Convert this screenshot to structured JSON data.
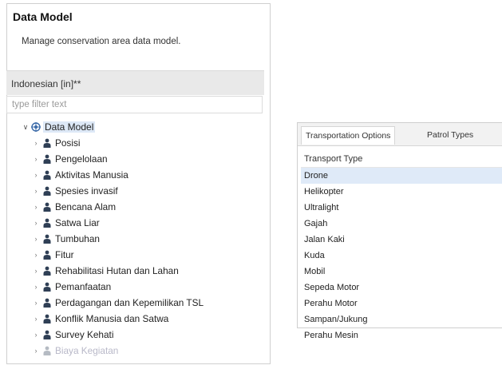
{
  "data_model_panel": {
    "title": "Data Model",
    "description": "Manage conservation area data model.",
    "language": "Indonesian [in]**",
    "filter_placeholder": "type filter text",
    "tree": {
      "root": "Data Model",
      "items": [
        {
          "label": "Posisi",
          "faded": false
        },
        {
          "label": "Pengelolaan",
          "faded": false
        },
        {
          "label": "Aktivitas Manusia",
          "faded": false
        },
        {
          "label": "Spesies invasif",
          "faded": false
        },
        {
          "label": "Bencana Alam",
          "faded": false
        },
        {
          "label": "Satwa Liar",
          "faded": false
        },
        {
          "label": "Tumbuhan",
          "faded": false
        },
        {
          "label": "Fitur",
          "faded": false
        },
        {
          "label": "Rehabilitasi Hutan dan Lahan",
          "faded": false
        },
        {
          "label": "Pemanfaatan",
          "faded": false
        },
        {
          "label": "Perdagangan dan Kepemilikan TSL",
          "faded": false
        },
        {
          "label": "Konflik Manusia dan Satwa",
          "faded": false
        },
        {
          "label": "Survey Kehati",
          "faded": false
        },
        {
          "label": "Biaya Kegiatan",
          "faded": true
        }
      ]
    },
    "icons": {
      "expand": "chevron-right-icon",
      "collapse": "chevron-down-icon",
      "category": "person-icon",
      "root": "data-model-icon"
    }
  },
  "transport_panel": {
    "tabs": [
      {
        "label": "Transportation Options",
        "active": true
      },
      {
        "label": "Patrol Types",
        "active": false
      }
    ],
    "column_header": "Transport Type",
    "rows": [
      {
        "label": "Drone",
        "selected": true
      },
      {
        "label": "Helikopter",
        "selected": false
      },
      {
        "label": "Ultralight",
        "selected": false
      },
      {
        "label": "Gajah",
        "selected": false
      },
      {
        "label": "Jalan Kaki",
        "selected": false
      },
      {
        "label": "Kuda",
        "selected": false
      },
      {
        "label": "Mobil",
        "selected": false
      },
      {
        "label": "Sepeda Motor",
        "selected": false
      },
      {
        "label": "Perahu Motor",
        "selected": false
      },
      {
        "label": "Sampan/Jukung",
        "selected": false
      },
      {
        "label": "Perahu Mesin",
        "selected": false
      }
    ]
  },
  "colors": {
    "selection": "#dfeaf8",
    "header_bar": "#e9e9e9",
    "border": "#cfcfcf",
    "faded_text": "#b8b8c8"
  }
}
